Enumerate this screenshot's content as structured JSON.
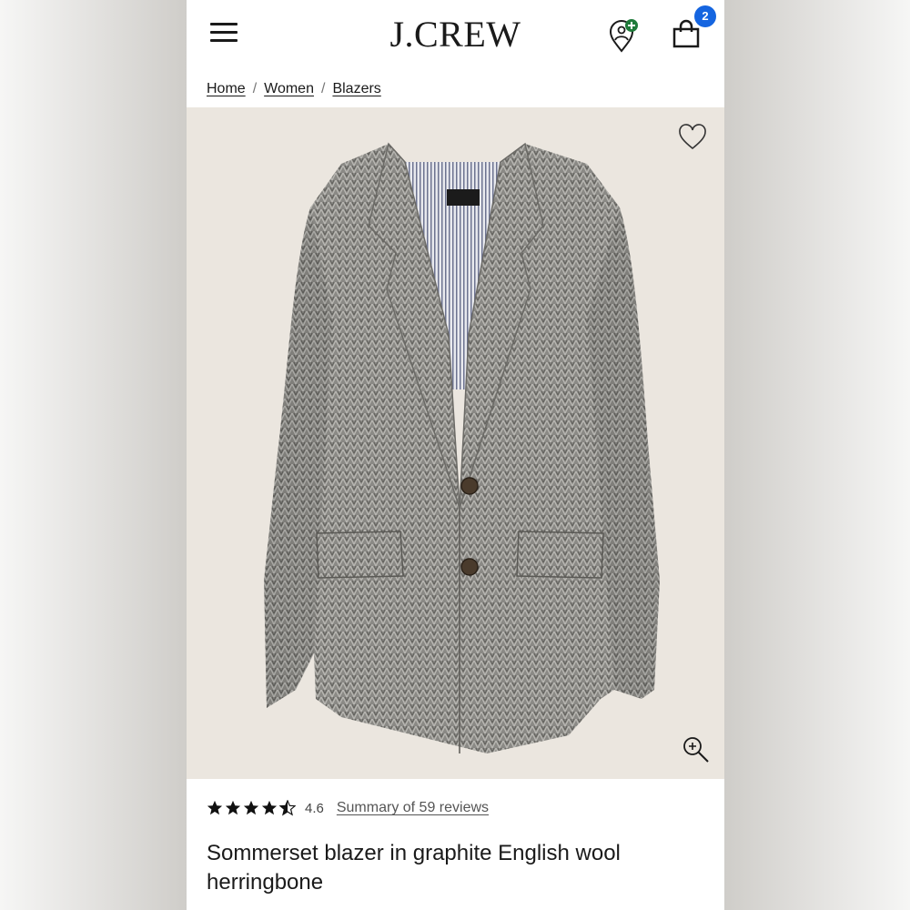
{
  "header": {
    "logo": "J.CREW",
    "bag_count": "2"
  },
  "breadcrumb": [
    "Home",
    "Women",
    "Blazers"
  ],
  "product": {
    "rating_value": "4.6",
    "rating_stars": 4.5,
    "reviews_link": "Summary of 59 reviews",
    "title": "Sommerset blazer in graphite English wool herringbone"
  },
  "icons": [
    "menu-icon",
    "store-locator-icon",
    "bag-icon",
    "heart-icon",
    "zoom-icon",
    "star-icon"
  ],
  "colors": {
    "badge": "#1565e0",
    "store_plus": "#1f7a3a",
    "image_bg": "#ebe6df",
    "text": "#1a1a1a"
  }
}
